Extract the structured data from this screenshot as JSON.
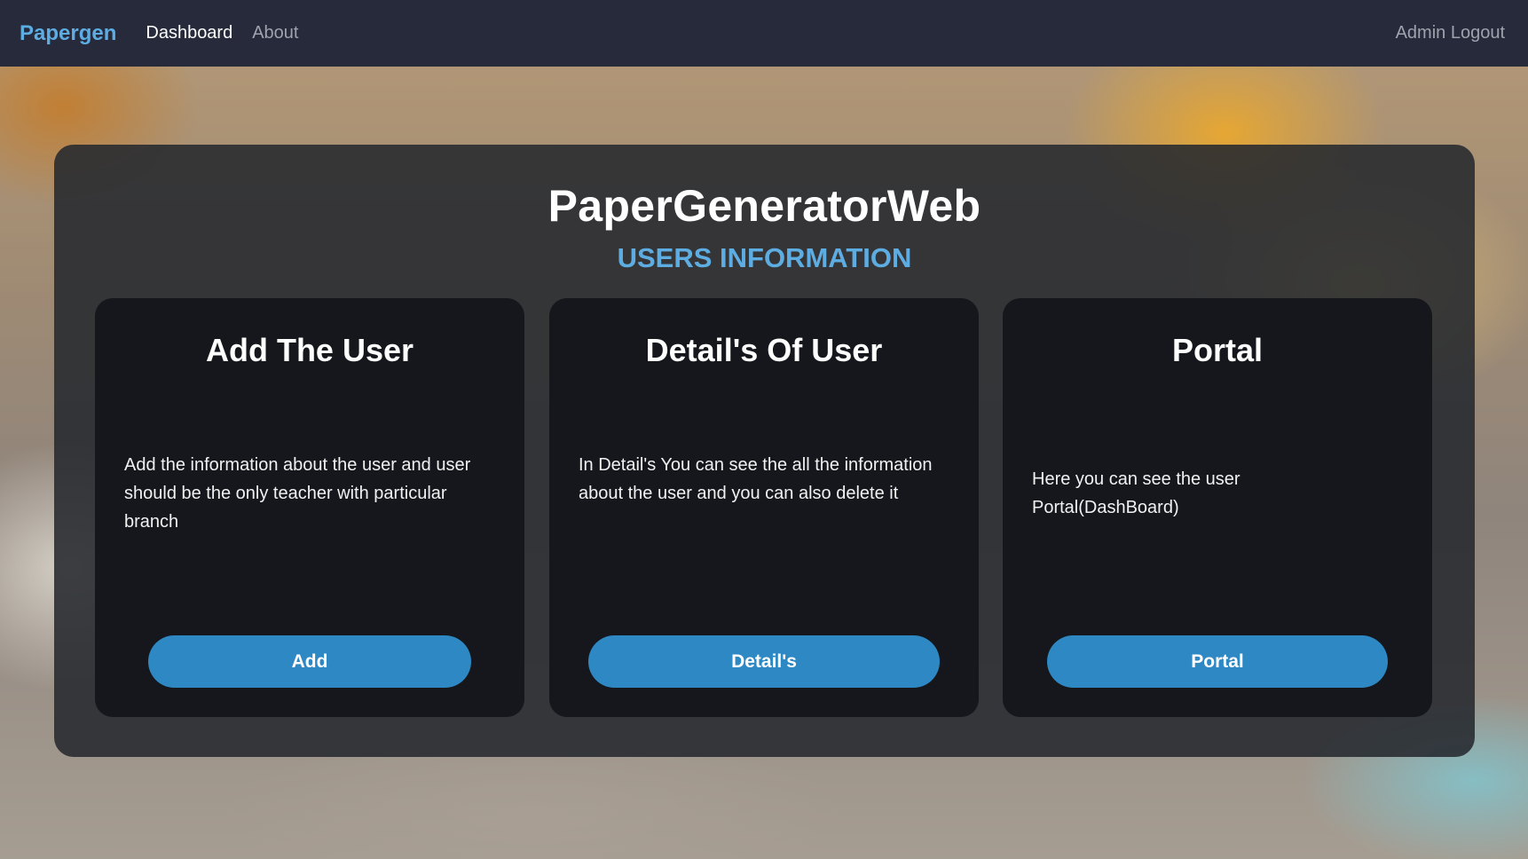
{
  "nav": {
    "brand": "Papergen",
    "links": [
      {
        "label": "Dashboard"
      },
      {
        "label": "About"
      }
    ],
    "logout": "Admin Logout"
  },
  "main": {
    "title": "PaperGeneratorWeb",
    "subtitle": "USERS INFORMATION",
    "cards": [
      {
        "title": "Add The User",
        "text": "Add the information about the user and user should be the only teacher with particular branch",
        "button": "Add"
      },
      {
        "title": "Detail's Of User",
        "text": "In Detail's You can see the all the information about the user and you can also delete it",
        "button": "Detail's"
      },
      {
        "title": "Portal",
        "text": "Here you can see the user Portal(DashBoard)",
        "button": "Portal"
      }
    ]
  },
  "colors": {
    "navbar": "#262a3b",
    "brand": "#5dade2",
    "accent_button": "#2e88c4",
    "panel": "#26292f",
    "card": "#12151a"
  }
}
